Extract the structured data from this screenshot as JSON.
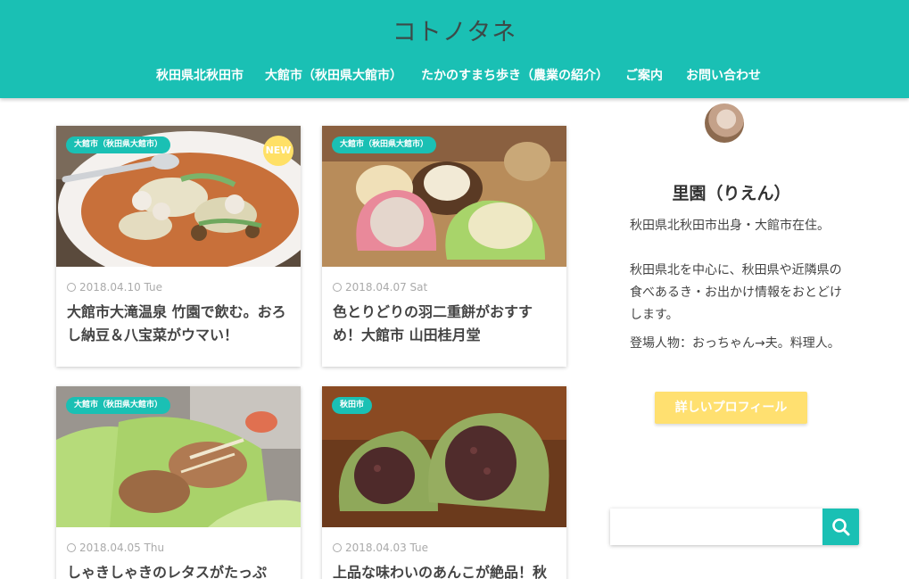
{
  "header": {
    "site_title": "コトノタネ",
    "background_color": "#1ac0b4",
    "nav": [
      {
        "label": "秋田県北秋田市"
      },
      {
        "label": "大館市（秋田県大館市）"
      },
      {
        "label": "たかのすまち歩き（農業の紹介）"
      },
      {
        "label": "ご案内"
      },
      {
        "label": "お問い合わせ"
      }
    ]
  },
  "posts": [
    {
      "category": "大館市（秋田県大館市）",
      "new_badge": "NEW",
      "date": "2018.04.10 Tue",
      "title": "大館市大滝温泉 竹園で飲む。おろし納豆＆八宝菜がウマい！",
      "image_subject": "hot-pot-with-vegetables"
    },
    {
      "category": "大館市（秋田県大館市）",
      "date": "2018.04.07 Sat",
      "title": "色とりどりの羽二重餅がおすすめ！大館市 山田桂月堂",
      "image_subject": "colorful-mochi-sweets"
    },
    {
      "category": "大館市（秋田県大館市）",
      "date": "2018.04.05 Thu",
      "title": "しゃきしゃきのレタスがたっぷ",
      "image_subject": "lettuce-wraps"
    },
    {
      "category": "秋田市",
      "date": "2018.04.03 Tue",
      "title": "上品な味わいのあんこが絶品！秋",
      "image_subject": "green-mochi-with-red-bean"
    }
  ],
  "sidebar": {
    "profile": {
      "name": "里園（りえん）",
      "bio_1": "秋田県北秋田市出身・大館市在住。",
      "bio_2": "秋田県北を中心に、秋田県や近隣県の食べあるき・お出かけ情報をおとどけします。",
      "bio_3": "登場人物：おっちゃん→夫。料理人。",
      "button_label": "詳しいプロフィール",
      "button_color": "#ffe070"
    },
    "search": {
      "placeholder": "",
      "icon": "search-icon"
    }
  }
}
